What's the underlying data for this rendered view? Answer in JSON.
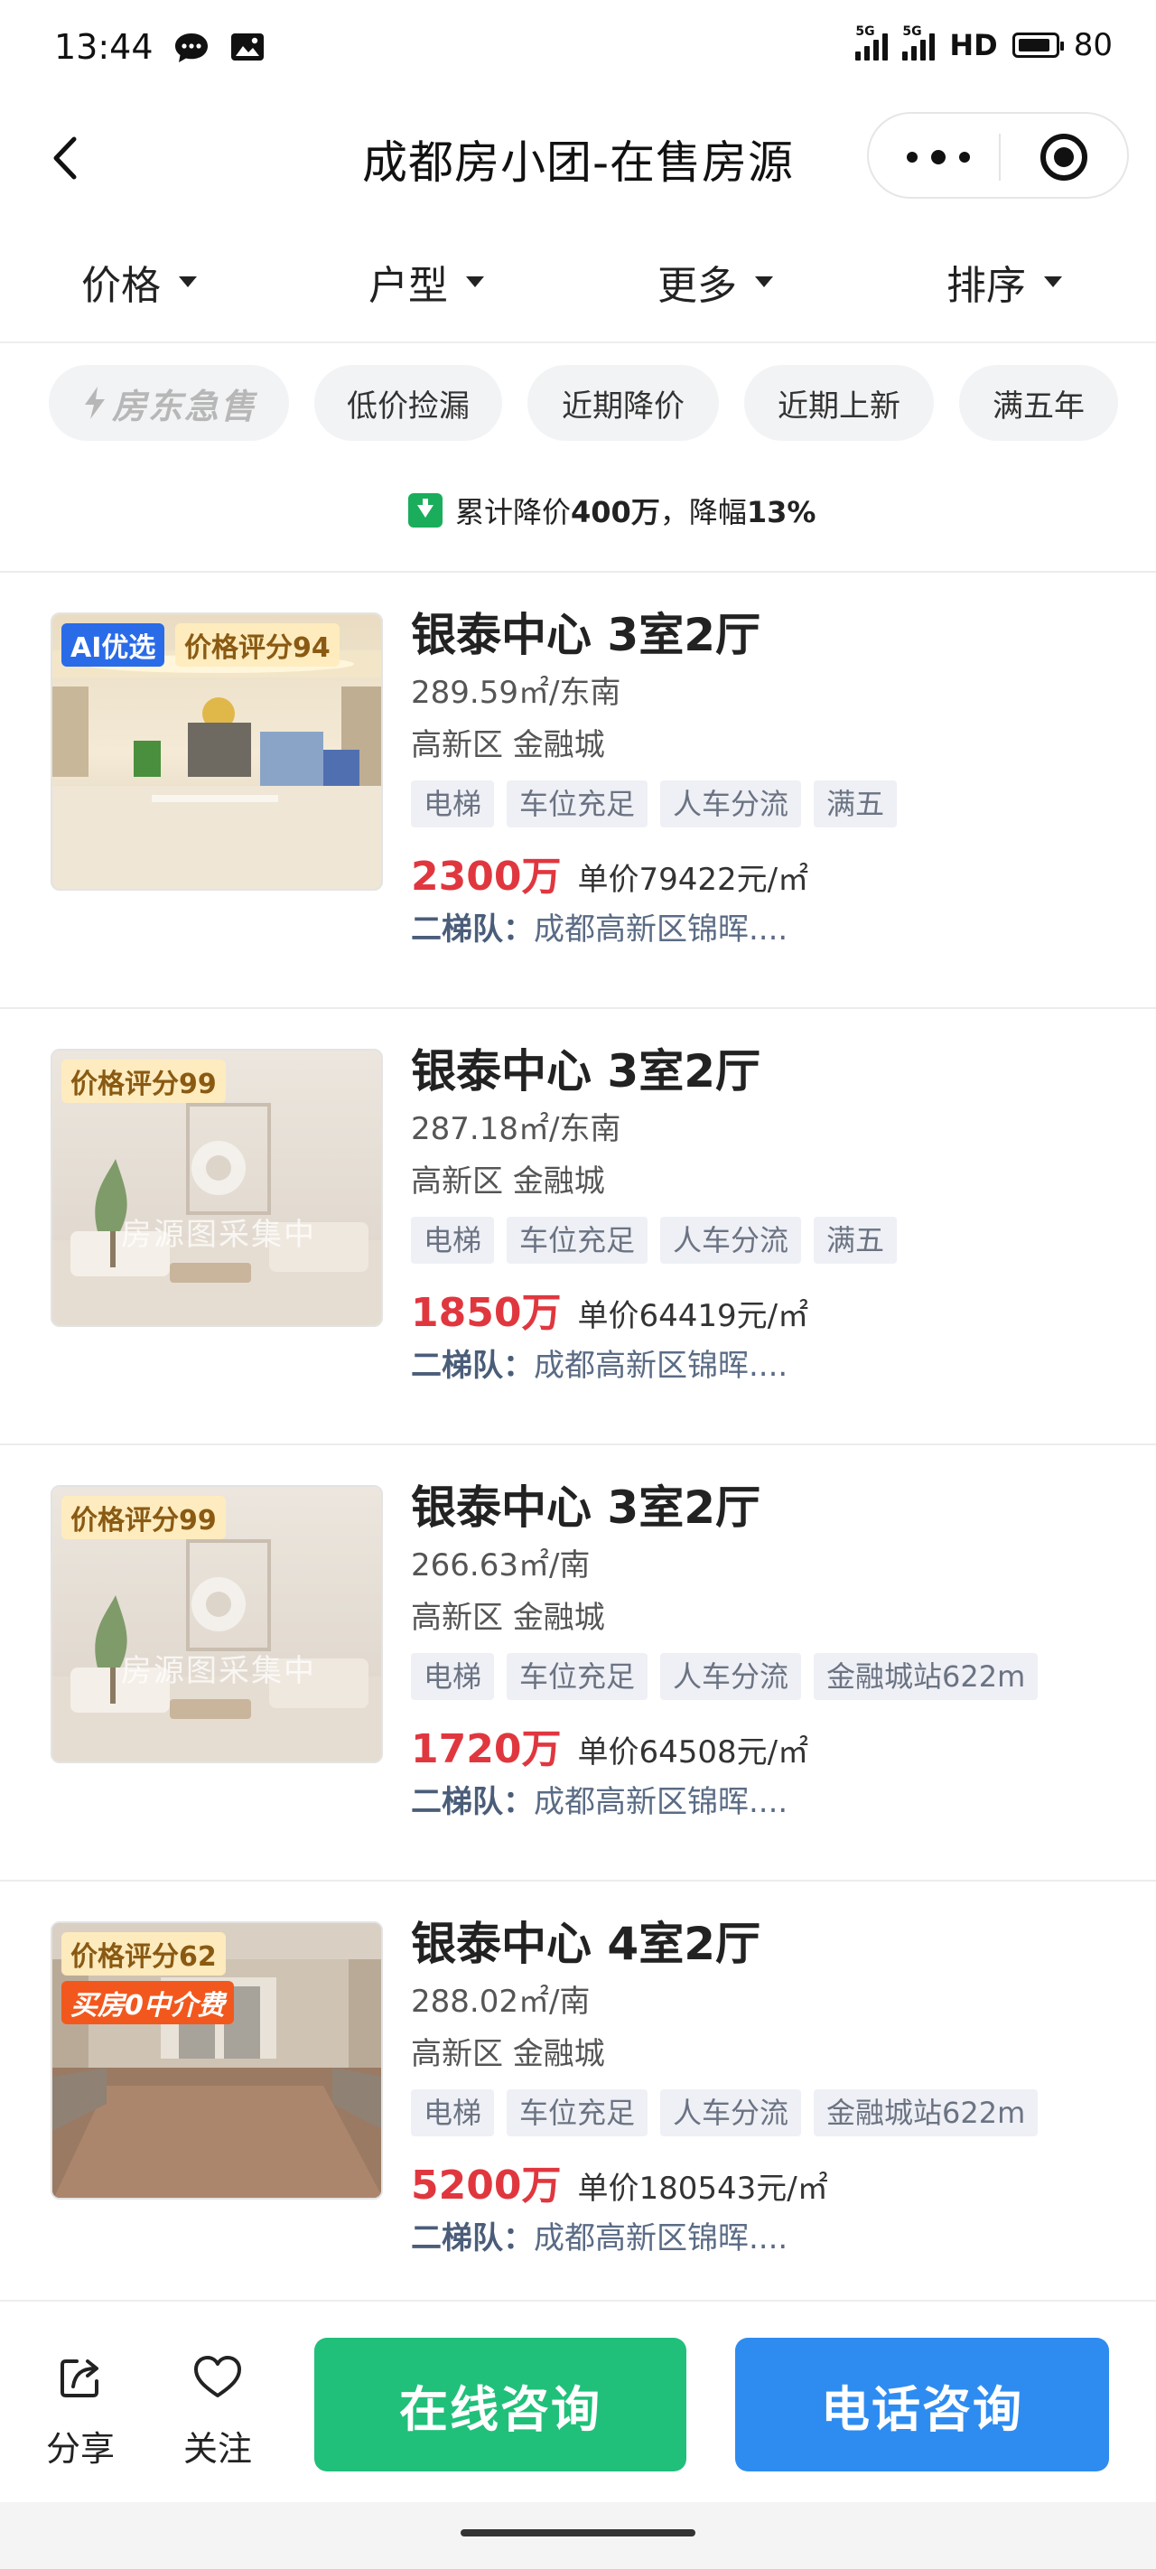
{
  "status_bar": {
    "time": "13:44",
    "signal_1": "5G",
    "signal_2": "5G",
    "hd": "HD",
    "battery": "80",
    "icons": [
      "chat-bubble-icon",
      "image-icon"
    ]
  },
  "nav": {
    "title": "成都房小团-在售房源"
  },
  "filters": [
    {
      "label": "价格"
    },
    {
      "label": "户型"
    },
    {
      "label": "更多"
    },
    {
      "label": "排序"
    }
  ],
  "chips": [
    {
      "label": "房东急售"
    },
    {
      "label": "低价捡漏"
    },
    {
      "label": "近期降价"
    },
    {
      "label": "近期上新"
    },
    {
      "label": "满五年"
    }
  ],
  "partial_listing": {
    "price_drop_prefix": "累计降价",
    "price_drop_amount": "400万",
    "price_drop_sep": "，降幅",
    "price_drop_rate": "13%"
  },
  "listings": [
    {
      "title": "银泰中心 3室2厅",
      "area": "289.59㎡/东南",
      "district": "高新区 金融城",
      "tags": [
        "电梯",
        "车位充足",
        "人车分流",
        "满五"
      ],
      "price": "2300万",
      "unit_price": "单价79422元/㎡",
      "team_label": "二梯队：",
      "team_text": "成都高新区锦晖....",
      "badges": {
        "ai": "AI优选",
        "score": "价格评分94",
        "fee": ""
      }
    },
    {
      "title": "银泰中心 3室2厅",
      "area": "287.18㎡/东南",
      "district": "高新区 金融城",
      "tags": [
        "电梯",
        "车位充足",
        "人车分流",
        "满五"
      ],
      "price": "1850万",
      "unit_price": "单价64419元/㎡",
      "team_label": "二梯队：",
      "team_text": "成都高新区锦晖....",
      "badges": {
        "ai": "",
        "score": "价格评分99",
        "fee": ""
      }
    },
    {
      "title": "银泰中心 3室2厅",
      "area": "266.63㎡/南",
      "district": "高新区 金融城",
      "tags": [
        "电梯",
        "车位充足",
        "人车分流",
        "金融城站622m"
      ],
      "price": "1720万",
      "unit_price": "单价64508元/㎡",
      "team_label": "二梯队：",
      "team_text": "成都高新区锦晖....",
      "badges": {
        "ai": "",
        "score": "价格评分99",
        "fee": ""
      }
    },
    {
      "title": "银泰中心 4室2厅",
      "area": "288.02㎡/南",
      "district": "高新区 金融城",
      "tags": [
        "电梯",
        "车位充足",
        "人车分流",
        "金融城站622m"
      ],
      "price": "5200万",
      "unit_price": "单价180543元/㎡",
      "team_label": "二梯队：",
      "team_text": "成都高新区锦晖....",
      "badges": {
        "ai": "",
        "score": "价格评分62",
        "fee": "买房0中介费"
      }
    }
  ],
  "placeholder_watermark": "房源图采集中",
  "actions": {
    "share": "分享",
    "follow": "关注",
    "online": "在线咨询",
    "phone": "电话咨询"
  },
  "colors": {
    "price_red": "#e0373f",
    "green_button": "#20c07a",
    "blue_button": "#2e8cf0",
    "ai_badge": "#2a6be8",
    "fee_badge": "#f2581d"
  }
}
